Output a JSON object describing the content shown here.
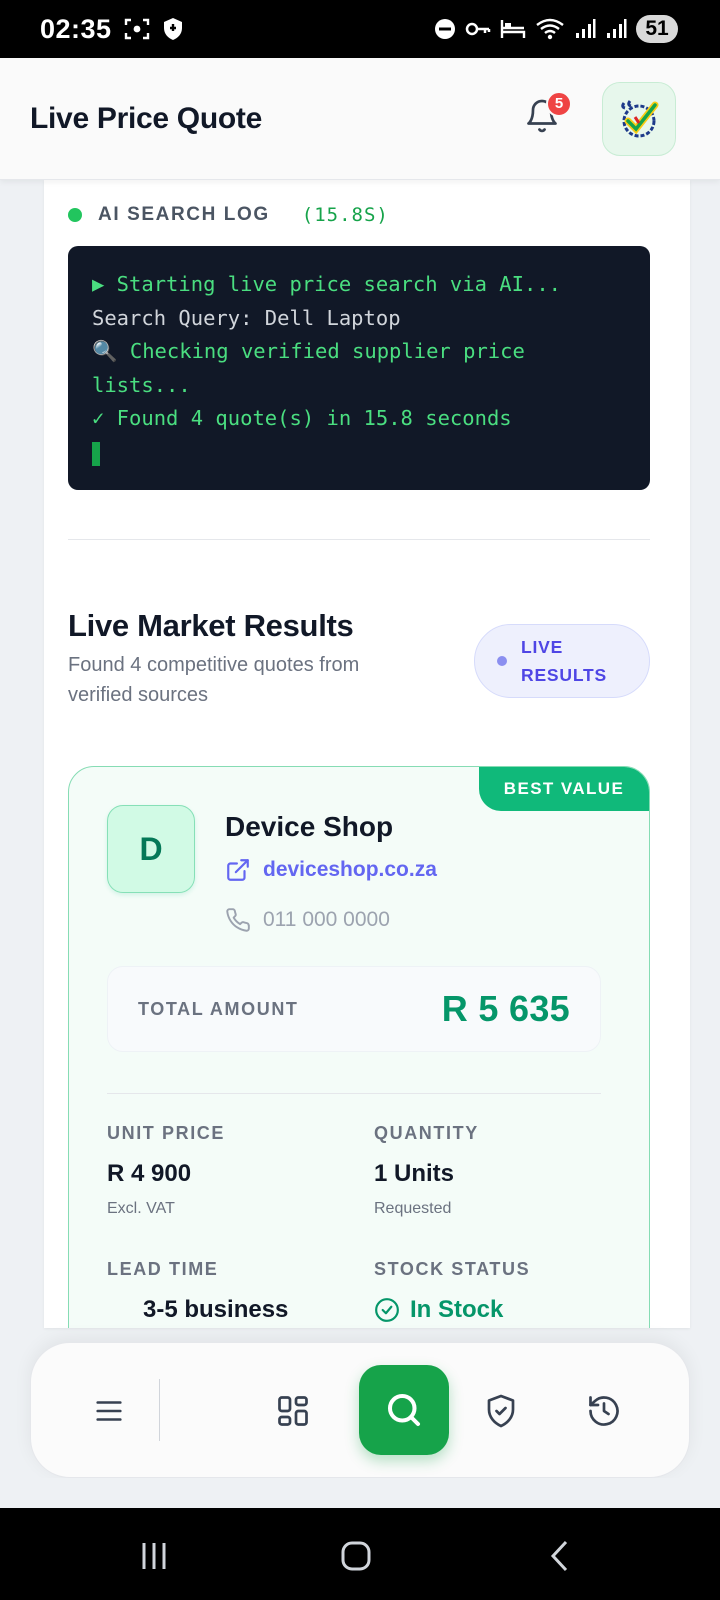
{
  "status_bar": {
    "time": "02:35",
    "battery": "51"
  },
  "header": {
    "title": "Live Price Quote",
    "notification_count": "5"
  },
  "search_log": {
    "title": "AI SEARCH LOG",
    "elapsed": "(15.8S)",
    "lines": [
      "▶ Starting live price search via AI...",
      "Search Query: Dell Laptop",
      "🔍 Checking verified supplier price lists...",
      "✓ Found 4 quote(s) in 15.8 seconds"
    ]
  },
  "results": {
    "title": "Live Market Results",
    "subtitle": "Found 4 competitive quotes from verified sources",
    "badge": "LIVE RESULTS"
  },
  "quote": {
    "badge": "BEST VALUE",
    "avatar_letter": "D",
    "supplier_name": "Device Shop",
    "website": "deviceshop.co.za",
    "phone": "011 000 0000",
    "total_label": "TOTAL AMOUNT",
    "total_value": "R 5 635",
    "unit_price_label": "UNIT PRICE",
    "unit_price_value": "R 4 900",
    "unit_price_note": "Excl. VAT",
    "quantity_label": "QUANTITY",
    "quantity_value": "1 Units",
    "quantity_note": "Requested",
    "lead_time_label": "LEAD TIME",
    "lead_time_value": "3-5 business",
    "stock_label": "STOCK STATUS",
    "stock_value": "In Stock"
  },
  "colors": {
    "accent_green": "#16a34a",
    "best_value_green": "#10b97a",
    "link_indigo": "#6366f1",
    "terminal_bg": "#111827"
  },
  "icons": [
    "hamburger-menu-icon",
    "grid-icon",
    "search-icon",
    "shield-check-icon",
    "history-icon",
    "bell-icon"
  ]
}
